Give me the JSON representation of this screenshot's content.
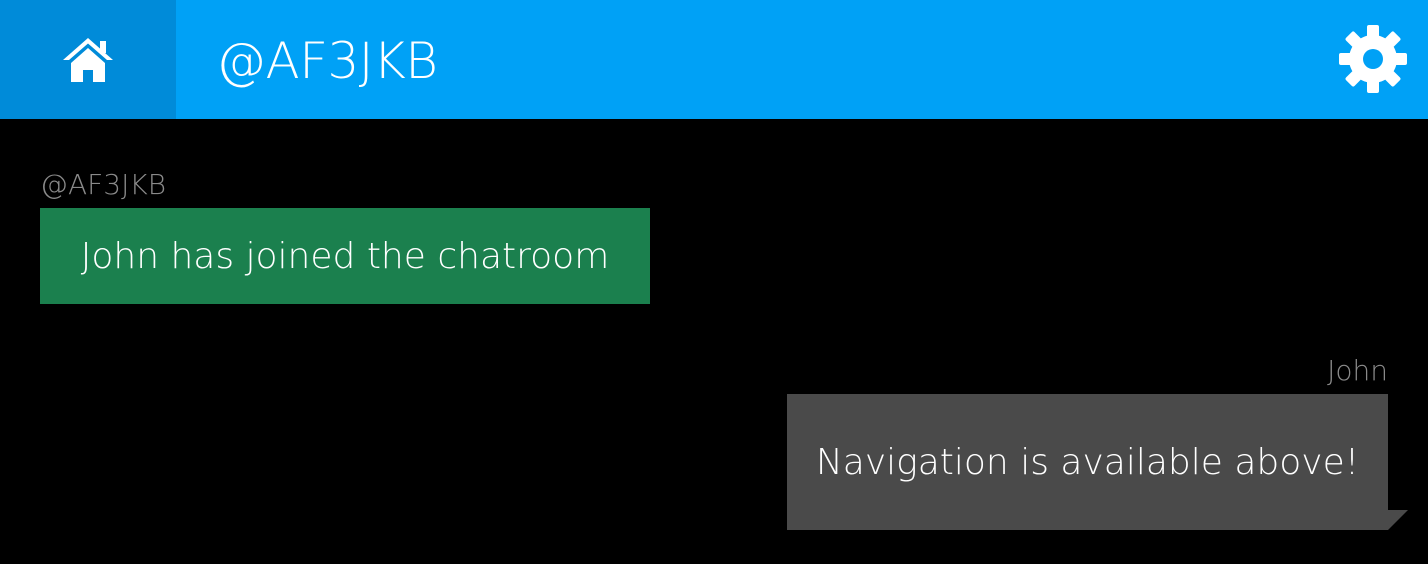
{
  "header": {
    "home_icon": "home-icon",
    "title": "@AF3JKB",
    "settings_icon": "gear-icon",
    "bar_color": "#00a1f6",
    "home_bg_color": "#008bd9"
  },
  "messages": [
    {
      "sender": "@AF3JKB",
      "text": "John has joined the chatroom",
      "align": "left",
      "color": "#1b804e"
    },
    {
      "sender": "John",
      "text": "Navigation is available above!",
      "align": "right",
      "color": "#4a4a4a"
    }
  ]
}
